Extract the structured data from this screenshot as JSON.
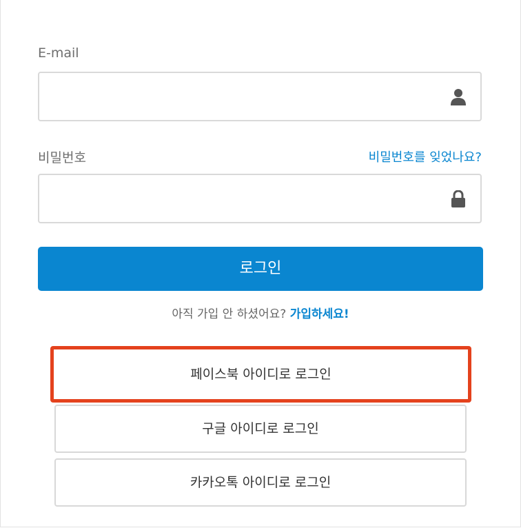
{
  "form": {
    "email_label": "E-mail",
    "email_value": "",
    "email_icon": "user-icon",
    "password_label": "비밀번호",
    "password_value": "",
    "password_icon": "lock-icon",
    "forgot_link": "비밀번호를 잊었나요?",
    "login_button": "로그인",
    "signup_prompt": "아직 가입 안 하셨어요?",
    "signup_link": "가입하세요!"
  },
  "social": {
    "facebook": "페이스북 아이디로 로그인",
    "google": "구글 아이디로 로그인",
    "kakao": "카카오톡 아이디로 로그인"
  },
  "colors": {
    "accent": "#0a86d0",
    "highlight_border": "#e4421d"
  }
}
